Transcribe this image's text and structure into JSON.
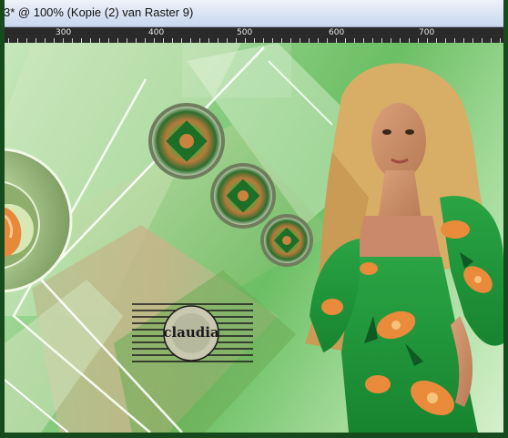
{
  "window": {
    "title": "3* @ 100% (Kopie (2) van Raster 9)"
  },
  "ruler": {
    "labels": [
      "300",
      "400",
      "500",
      "600",
      "700"
    ]
  },
  "canvas": {
    "watermark": "claudia",
    "colors": {
      "background_green": "#6bbf64",
      "dress_green": "#1e9a3a",
      "flower_orange": "#e9873a",
      "hair_blonde": "#d9b06a"
    }
  }
}
